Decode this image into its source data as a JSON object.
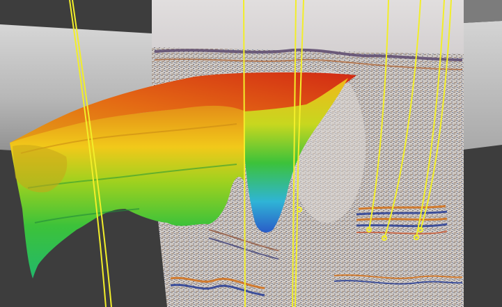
{
  "scene": {
    "kind": "3d-seismic-visualization",
    "colors": {
      "background_light": "#c4c4c4",
      "background_dark": "#3d3d3d",
      "seismic_panel_top": "#d2cfd0",
      "seismic_noise": "#8d8580",
      "reflector_orange": "#d07a2e",
      "reflector_blue": "#3d4f9a",
      "well_line": "#f2ee2a",
      "surface_high": "#d22a14",
      "surface_mid": "#f2d21a",
      "surface_low_green": "#3cc23a",
      "surface_deepest": "#2a5cc8"
    },
    "icons": [
      "seismic-section",
      "horizon-surface",
      "well-trajectory",
      "well-marker"
    ]
  }
}
